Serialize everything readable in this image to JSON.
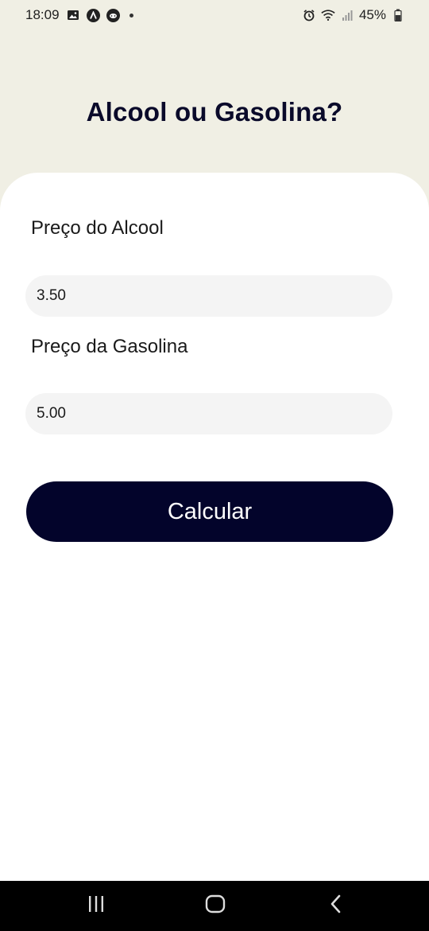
{
  "status_bar": {
    "time": "18:09",
    "battery": "45%",
    "icons": [
      "gallery-icon",
      "app-icon",
      "game-icon",
      "dot-icon",
      "alarm-icon",
      "wifi-icon",
      "signal-icon",
      "battery-icon"
    ]
  },
  "header": {
    "title": "Alcool ou Gasolina?"
  },
  "form": {
    "alcohol": {
      "label": "Preço do Alcool",
      "value": "3.50"
    },
    "gasoline": {
      "label": "Preço da Gasolina",
      "value": "5.00"
    },
    "calculate_label": "Calcular"
  },
  "colors": {
    "header_bg": "#f0efe4",
    "card_bg": "#ffffff",
    "input_bg": "#f4f4f4",
    "button_bg": "#03042b",
    "title_color": "#0a0a2a",
    "nav_bg": "#000000"
  },
  "nav": {
    "buttons": [
      "recents-icon",
      "home-icon",
      "back-icon"
    ]
  }
}
